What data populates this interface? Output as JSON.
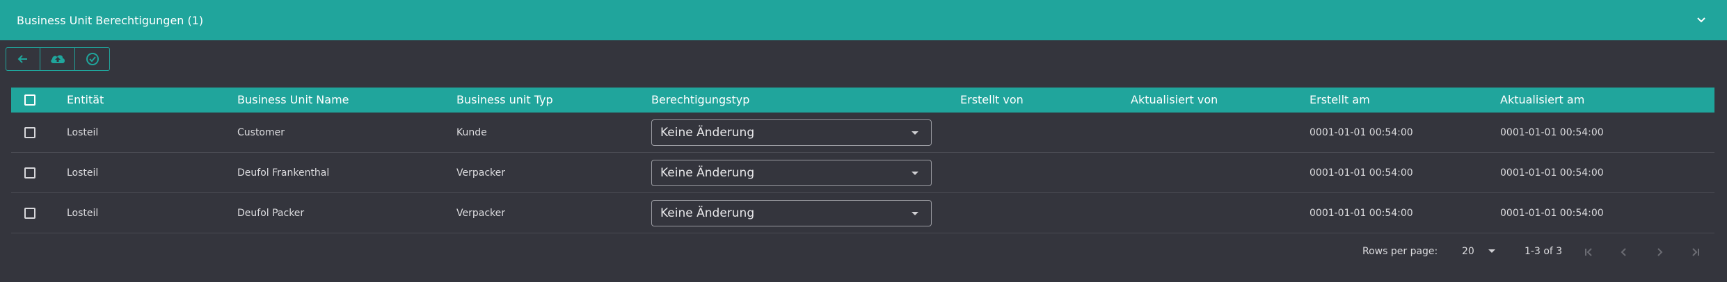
{
  "panel": {
    "title": "Business Unit Berechtigungen (1)"
  },
  "toolbar": {
    "back_icon": "arrow-left-icon",
    "upload_icon": "cloud-upload-icon",
    "confirm_icon": "check-circle-icon"
  },
  "table": {
    "headers": [
      "Entität",
      "Business Unit Name",
      "Business unit Typ",
      "Berechtigungstyp",
      "Erstellt von",
      "Aktualisiert von",
      "Erstellt am",
      "Aktualisiert am"
    ],
    "rows": [
      {
        "entity": "Losteil",
        "bu_name": "Customer",
        "bu_type": "Kunde",
        "permission": "Keine Änderung",
        "created_by": "",
        "updated_by": "",
        "created_at": "0001-01-01 00:54:00",
        "updated_at": "0001-01-01 00:54:00"
      },
      {
        "entity": "Losteil",
        "bu_name": "Deufol Frankenthal",
        "bu_type": "Verpacker",
        "permission": "Keine Änderung",
        "created_by": "",
        "updated_by": "",
        "created_at": "0001-01-01 00:54:00",
        "updated_at": "0001-01-01 00:54:00"
      },
      {
        "entity": "Losteil",
        "bu_name": "Deufol Packer",
        "bu_type": "Verpacker",
        "permission": "Keine Änderung",
        "created_by": "",
        "updated_by": "",
        "created_at": "0001-01-01 00:54:00",
        "updated_at": "0001-01-01 00:54:00"
      }
    ]
  },
  "pagination": {
    "rows_per_page_label": "Rows per page:",
    "rows_per_page": "20",
    "range": "1-3 of 3"
  },
  "colors": {
    "accent": "#20a59c",
    "background": "#34353d",
    "divider": "#4a4b53"
  }
}
